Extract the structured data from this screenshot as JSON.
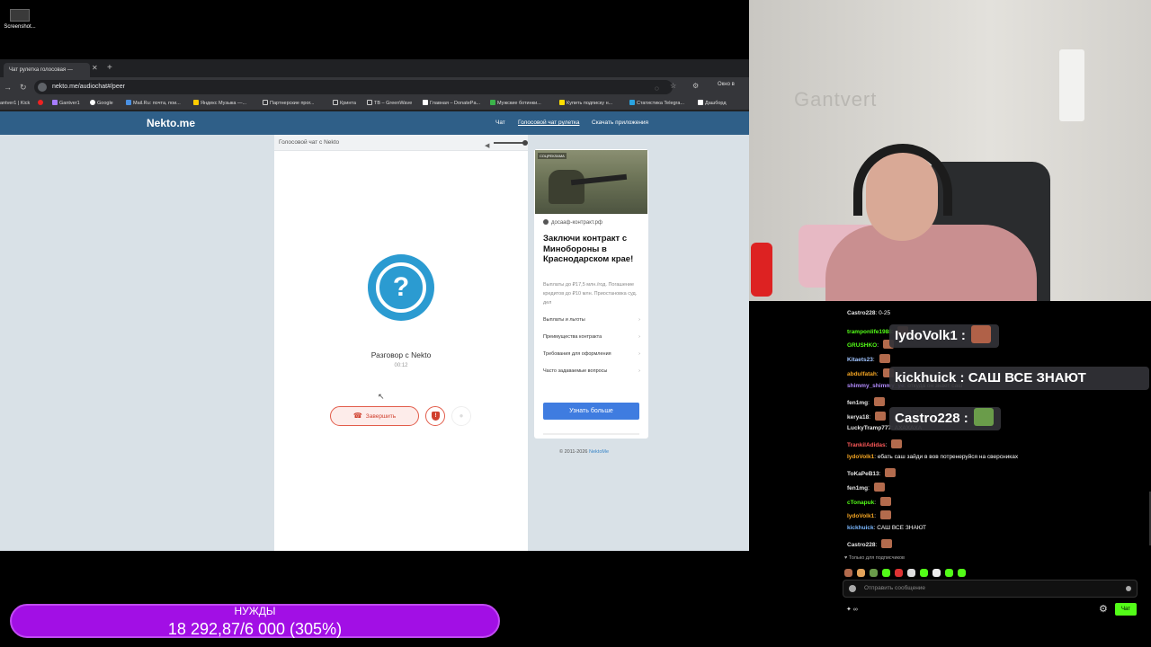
{
  "desktop": {
    "icon_label": "Screenshot..."
  },
  "browser": {
    "tab_title": "Чат рулетка голосовая —",
    "url": "nekto.me/audiochat#/peer",
    "window_label": "Окно в",
    "bookmarks": [
      "antver1 | Kick",
      "Gantver1",
      "Google",
      "Mail.Ru: почта, пои...",
      "Яндекс Музыка —...",
      "Партнерские прог...",
      "Кринта",
      "TB – GreenWave",
      "Главная – DonatePa...",
      "Мужские ботинки...",
      "Купить подписку н...",
      "Статистика Telegra...",
      "Дашборд"
    ]
  },
  "site": {
    "logo": "Nekto.me",
    "nav": {
      "chat": "Чат",
      "voice": "Голосовой чат рулетка",
      "apps": "Скачать приложения"
    },
    "panel_title": "Голосовой чат с Nekto",
    "peer_title": "Разговор с Nekto",
    "timer": "00:12",
    "end_button": "Завершить",
    "avatar_symbol": "?",
    "copyright_prefix": "© 2011-2026",
    "copyright_link": "NektoMe"
  },
  "ad": {
    "photo_tag": "СОЦРЕКЛАМА",
    "domain": "досааф-контракт.рф",
    "headline": "Заключи контракт с Минобороны в Краснодарском крае!",
    "subtext": "Выплаты до ₽17,5 млн./год. Погашение кредитов до ₽10 млн. Приостановка суд. дел",
    "links": [
      "Выплаты и льготы",
      "Преимущества контракта",
      "Требования для оформления",
      "Часто задаваемые вопросы"
    ],
    "cta": "Узнать больше"
  },
  "webcam": {
    "sign": "Gantvert"
  },
  "chat": {
    "messages": [
      {
        "user": "Castro228",
        "text": "0-25",
        "color": "#e6e6e6"
      },
      {
        "user": "tramponlife1988",
        "text": "",
        "color": "#53fc18"
      },
      {
        "user": "GRUSHKO",
        "text": "",
        "color": "#53fc18"
      },
      {
        "user": "Kitaets23",
        "text": "",
        "color": "#a0c4ff"
      },
      {
        "user": "abdulfatah",
        "text": "",
        "color": "#f5a623"
      },
      {
        "user": "shimmy_shimmy_ye",
        "text": "откуда он знает саш",
        "color": "#b48cff"
      },
      {
        "user": "fen1mg",
        "text": "",
        "color": "#e6e6e6"
      },
      {
        "user": "kerya18",
        "text": "",
        "color": "#e6e6e6"
      },
      {
        "user": "LuckyTramp777",
        "text": "АХАХАХА",
        "color": "#e6e6e6"
      },
      {
        "user": "TrankilAdidas",
        "text": "",
        "color": "#ff5a5a"
      },
      {
        "user": "IydoVolk1",
        "text": "ебать саш зайди в вов потренеруйся на сверсниках",
        "color": "#f5a623"
      },
      {
        "user": "ToKaPeB13",
        "text": "",
        "color": "#e6e6e6"
      },
      {
        "user": "fen1mg",
        "text": "",
        "color": "#e6e6e6"
      },
      {
        "user": "cTonapuk",
        "text": "",
        "color": "#53fc18"
      },
      {
        "user": "IydoVolk1",
        "text": "",
        "color": "#f5a623"
      },
      {
        "user": "kickhuick",
        "text": "САШ ВСЕ ЗНАЮТ",
        "color": "#7ab8ff"
      },
      {
        "user": "Castro228",
        "text": "",
        "color": "#e6e6e6"
      }
    ],
    "overlays": [
      {
        "text": "IydoVolk1 :"
      },
      {
        "text": "kickhuick : САШ ВСЕ ЗНАЮТ"
      },
      {
        "text": "Castro228 :"
      }
    ],
    "sub_only": "Только для подписчиков",
    "input_placeholder": "Отправить сообщение",
    "send_label": "Чат",
    "accent_color": "#53fc18"
  },
  "goal": {
    "title": "НУЖДЫ",
    "value": "18 292,87/6 000 (305%)"
  }
}
